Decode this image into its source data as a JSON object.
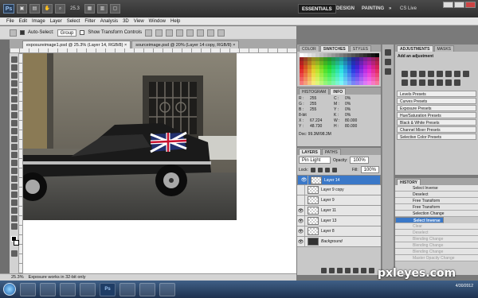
{
  "app": {
    "logo": "Ps",
    "zoom": "25.3"
  },
  "workspaces": {
    "essentials": "ESSENTIALS",
    "design": "DESIGN",
    "painting": "PAINTING",
    "more": "»",
    "cslive": "CS Live"
  },
  "menu": [
    "File",
    "Edit",
    "Image",
    "Layer",
    "Select",
    "Filter",
    "Analysis",
    "3D",
    "View",
    "Window",
    "Help"
  ],
  "options": {
    "auto_select_label": "Auto-Select:",
    "auto_select_value": "Group",
    "transform_label": "Show Transform Controls"
  },
  "tabs": [
    {
      "label": "exposureimage1.psd @ 25.3% (Layer 14, RGB/8) ×",
      "active": true
    },
    {
      "label": "sourceimage.psd @ 20% (Layer 14 copy, RGB/8) ×",
      "active": false
    }
  ],
  "status": {
    "zoom": "25.3%",
    "message": "Exposure works in 32-bit only"
  },
  "color_panel": {
    "tabs": [
      "COLOR",
      "SWATCHES",
      "STYLES"
    ],
    "active": "SWATCHES"
  },
  "info_panel": {
    "tabs": [
      "HISTOGRAM",
      "INFO"
    ],
    "active": "INFO",
    "rows": [
      {
        "a": "R :",
        "av": "255",
        "b": "C :",
        "bv": "0%"
      },
      {
        "a": "G :",
        "av": "255",
        "b": "M :",
        "bv": "0%"
      },
      {
        "a": "B :",
        "av": "255",
        "b": "Y :",
        "bv": "0%"
      },
      {
        "a": "8-bit",
        "av": "",
        "b": "K :",
        "bv": "0%"
      },
      {
        "a": "X :",
        "av": "67.224",
        "b": "W :",
        "bv": "80.000"
      },
      {
        "a": "Y :",
        "av": "48.730",
        "b": "H :",
        "bv": "80.000"
      }
    ],
    "doc": "Doc: 99.3M/98.3M"
  },
  "layers_panel": {
    "tabs": [
      "LAYERS",
      "PATHS"
    ],
    "active": "LAYERS",
    "blend": "Pin Light",
    "opacity_label": "Opacity:",
    "opacity": "100%",
    "lock_label": "Lock:",
    "fill_label": "Fill:",
    "fill": "100%",
    "layers": [
      {
        "name": "Layer 14",
        "visible": true,
        "selected": true
      },
      {
        "name": "Layer 9 copy",
        "visible": false,
        "selected": false
      },
      {
        "name": "Layer 9",
        "visible": false,
        "selected": false
      },
      {
        "name": "Layer 11",
        "visible": true,
        "selected": false
      },
      {
        "name": "Layer 13",
        "visible": true,
        "selected": false
      },
      {
        "name": "Layer 8",
        "visible": true,
        "selected": false
      },
      {
        "name": "Background",
        "visible": true,
        "selected": false
      }
    ]
  },
  "adjustments": {
    "tabs": [
      "ADJUSTMENTS",
      "MASKS"
    ],
    "active": "ADJUSTMENTS",
    "title": "Add an adjustment",
    "presets": [
      "Levels Presets",
      "Curves Presets",
      "Exposure Presets",
      "Hue/Saturation Presets",
      "Black & White Presets",
      "Channel Mixer Presets",
      "Selective Color Presets"
    ]
  },
  "history": {
    "tab": "HISTORY",
    "items": [
      {
        "label": "Select Inverse",
        "state": "normal"
      },
      {
        "label": "Deselect",
        "state": "normal"
      },
      {
        "label": "Free Transform",
        "state": "normal"
      },
      {
        "label": "Free Transform",
        "state": "normal"
      },
      {
        "label": "Selection Change",
        "state": "normal"
      },
      {
        "label": "Select Inverse",
        "state": "selected"
      },
      {
        "label": "Clear",
        "state": "dim"
      },
      {
        "label": "Deselect",
        "state": "dim"
      },
      {
        "label": "Blending Change",
        "state": "dim"
      },
      {
        "label": "Blending Change",
        "state": "dim"
      },
      {
        "label": "Blending Change",
        "state": "dim"
      },
      {
        "label": "Master Opacity Change",
        "state": "dim"
      }
    ]
  },
  "taskbar": {
    "apps": [
      "",
      "",
      "",
      "",
      "Ps",
      "",
      "",
      ""
    ],
    "time": "",
    "date": "4/30/2012"
  },
  "watermark": "pxleyes.com"
}
